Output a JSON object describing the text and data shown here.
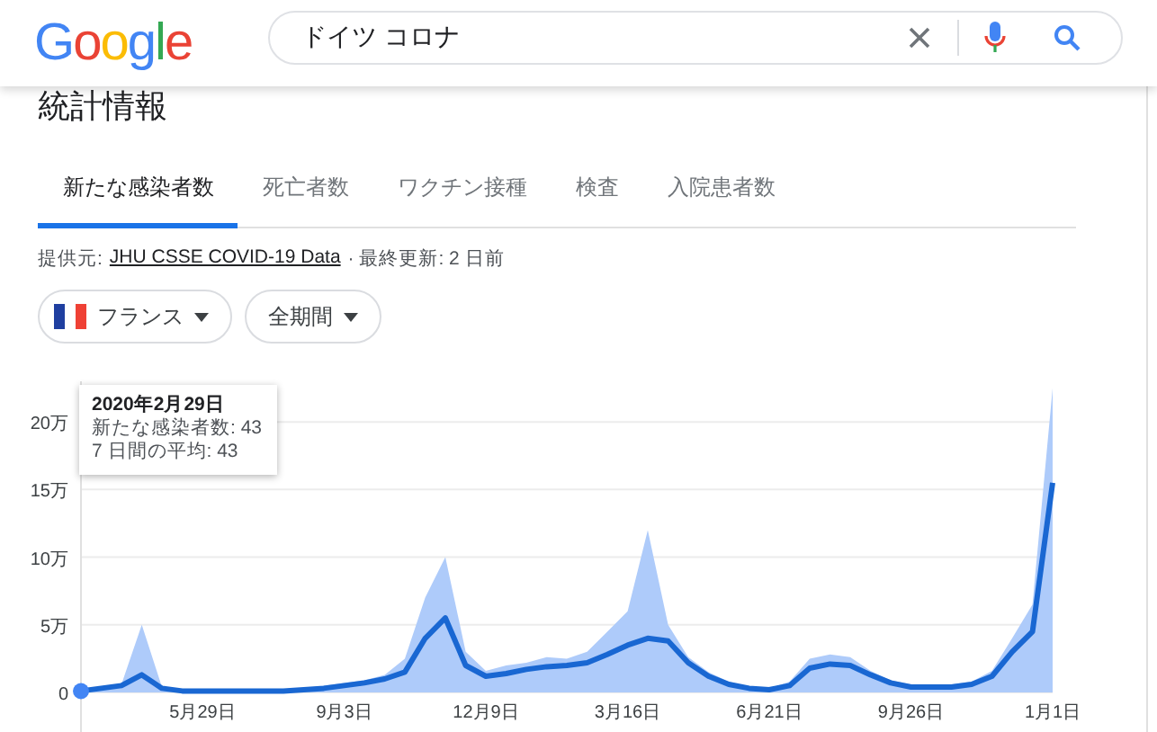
{
  "header": {
    "logo": "Google",
    "search": {
      "value": "ドイツ コロナ"
    }
  },
  "section_title": "統計情報",
  "tabs": [
    {
      "label": "新たな感染者数",
      "selected": true
    },
    {
      "label": "死亡者数",
      "selected": false
    },
    {
      "label": "ワクチン接種",
      "selected": false
    },
    {
      "label": "検査",
      "selected": false
    },
    {
      "label": "入院患者数",
      "selected": false
    }
  ],
  "source": {
    "prefix": "提供元:",
    "link": "JHU CSSE COVID-19 Data",
    "updated": "· 最終更新: 2 日前"
  },
  "filters": [
    {
      "label": "フランス",
      "kind": "flag"
    },
    {
      "label": "全期間",
      "kind": "plain"
    }
  ],
  "tooltip": {
    "date": "2020年2月29日",
    "lines": [
      "新たな感染者数: 43",
      "7 日間の平均: 43"
    ]
  },
  "chart_data": {
    "type": "area",
    "categories": [
      null,
      null,
      null,
      null,
      null,
      null,
      "5月29日",
      null,
      null,
      null,
      null,
      null,
      null,
      "9月3日",
      null,
      null,
      null,
      null,
      null,
      null,
      "12月9日",
      null,
      null,
      null,
      null,
      null,
      null,
      "3月16日",
      null,
      null,
      null,
      null,
      null,
      null,
      "6月21日",
      null,
      null,
      null,
      null,
      null,
      null,
      "9月26日",
      null,
      null,
      null,
      null,
      null,
      null,
      "1月1日"
    ],
    "series": [
      {
        "type": "area",
        "color": "#aecbfa",
        "values": [
          0.3,
          0.4,
          0.6,
          5,
          0.4,
          0.2,
          0.1,
          0.1,
          0.1,
          0.1,
          0.2,
          0.3,
          0.5,
          0.7,
          0.9,
          1.3,
          2.5,
          7,
          10,
          3,
          1.6,
          2,
          2.2,
          2.6,
          2.5,
          3,
          4.5,
          6,
          12,
          5,
          2.6,
          1.5,
          0.8,
          0.4,
          0.3,
          0.8,
          2.5,
          2.8,
          2.6,
          1.6,
          0.9,
          0.6,
          0.5,
          0.6,
          0.8,
          1.6,
          4,
          6.5,
          22.5
        ]
      },
      {
        "type": "line",
        "color": "#1967d2",
        "values": [
          0.1,
          0.3,
          0.5,
          1.3,
          0.3,
          0.1,
          0.1,
          0.1,
          0.1,
          0.1,
          0.1,
          0.2,
          0.3,
          0.5,
          0.7,
          1,
          1.5,
          4,
          5.5,
          2,
          1.2,
          1.4,
          1.7,
          1.9,
          2,
          2.2,
          2.8,
          3.5,
          4,
          3.8,
          2.2,
          1.2,
          0.6,
          0.3,
          0.2,
          0.5,
          1.8,
          2.1,
          2,
          1.3,
          0.7,
          0.4,
          0.4,
          0.4,
          0.6,
          1.2,
          3,
          4.5,
          15.5
        ]
      }
    ],
    "ylim": [
      0,
      23
    ],
    "yticks": [
      {
        "value": 0,
        "label": "0"
      },
      {
        "value": 5,
        "label": "5万"
      },
      {
        "value": 10,
        "label": "10万"
      },
      {
        "value": 15,
        "label": "15万"
      },
      {
        "value": 20,
        "label": "20万"
      }
    ],
    "stacked": false,
    "grid": true
  }
}
